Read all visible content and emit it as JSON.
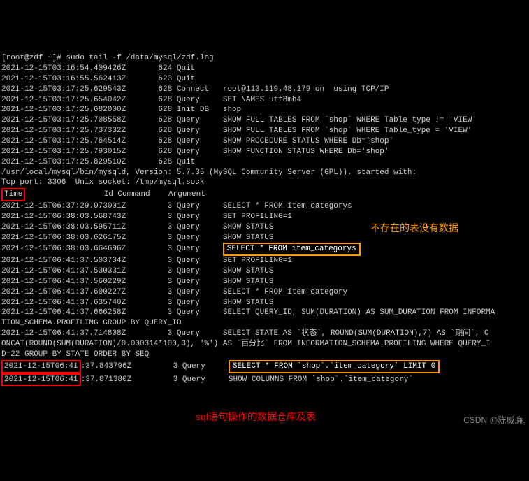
{
  "prompt": "[root@zdf ~]# sudo tail -f /data/mysql/zdf.log",
  "log_lines": [
    "2021-12-15T03:16:54.409426Z       624 Quit",
    "2021-12-15T03:16:55.562413Z       623 Quit",
    "2021-12-15T03:17:25.629543Z       628 Connect   root@113.119.48.179 on  using TCP/IP",
    "2021-12-15T03:17:25.654042Z       628 Query     SET NAMES utf8mb4",
    "2021-12-15T03:17:25.682000Z       628 Init DB   shop",
    "2021-12-15T03:17:25.708558Z       628 Query     SHOW FULL TABLES FROM `shop` WHERE Table_type != 'VIEW'",
    "2021-12-15T03:17:25.737332Z       628 Query     SHOW FULL TABLES FROM `shop` WHERE Table_type = 'VIEW'",
    "2021-12-15T03:17:25.764514Z       628 Query     SHOW PROCEDURE STATUS WHERE Db='shop'",
    "2021-12-15T03:17:25.793015Z       628 Query     SHOW FUNCTION STATUS WHERE Db='shop'",
    "2021-12-15T03:17:25.829510Z       628 Quit"
  ],
  "mysqld_info": "/usr/local/mysql/bin/mysqld, Version: 5.7.35 (MySQL Community Server (GPL)). started with:",
  "tcp_info": "Tcp port: 3306  Unix socket: /tmp/mysql.sock",
  "header": {
    "time_boxed": "Time",
    "rest": "                 Id Command    Argument"
  },
  "query_lines_1": [
    "2021-12-15T06:37:29.073001Z         3 Query     SELECT * FROM item_categorys",
    "2021-12-15T06:38:03.568743Z         3 Query     SET PROFILING=1",
    "2021-12-15T06:38:03.595711Z         3 Query     SHOW STATUS",
    "2021-12-15T06:38:03.626175Z         3 Query     SHOW STATUS"
  ],
  "highlighted_query_line": {
    "prefix": "2021-12-15T06:38:03.664696Z         3 Query     ",
    "highlighted": "SELECT * FROM item_categorys"
  },
  "query_lines_2": [
    "2021-12-15T06:41:37.503734Z         3 Query     SET PROFILING=1",
    "2021-12-15T06:41:37.530331Z         3 Query     SHOW STATUS",
    "2021-12-15T06:41:37.560229Z         3 Query     SHOW STATUS",
    "2021-12-15T06:41:37.600227Z         3 Query     SELECT * FROM item_category",
    "2021-12-15T06:41:37.635740Z         3 Query     SHOW STATUS"
  ],
  "long_query": "2021-12-15T06:41:37.666258Z         3 Query     SELECT QUERY_ID, SUM(DURATION) AS SUM_DURATION FROM INFORMA\nTION_SCHEMA.PROFILING GROUP BY QUERY_ID",
  "long_query2": "2021-12-15T06:41:37.714808Z         3 Query     SELECT STATE AS `状态`, ROUND(SUM(DURATION),7) AS `期间`, C\nONCAT(ROUND(SUM(DURATION)/0.000314*100,3), '%') AS `百分比` FROM INFORMATION_SCHEMA.PROFILING WHERE QUERY_I\nD=22 GROUP BY STATE ORDER BY SEQ",
  "final_lines": {
    "line1_boxed": "2021-12-15T06:41",
    "line1_rest": ":37.843796Z         3 Query     ",
    "line1_orange": "SELECT * FROM `shop`.`item_category` LIMIT 0",
    "line2_boxed": "2021-12-15T06:41",
    "line2_rest": ":37.871380Z         3 Query     SHOW COLUMNS FROM `shop`.`item_category`"
  },
  "annotations": {
    "orange": "不存在的表没有数据",
    "red": "sql语句操作的数据仓库及表"
  },
  "watermark": "CSDN @陈威廉."
}
